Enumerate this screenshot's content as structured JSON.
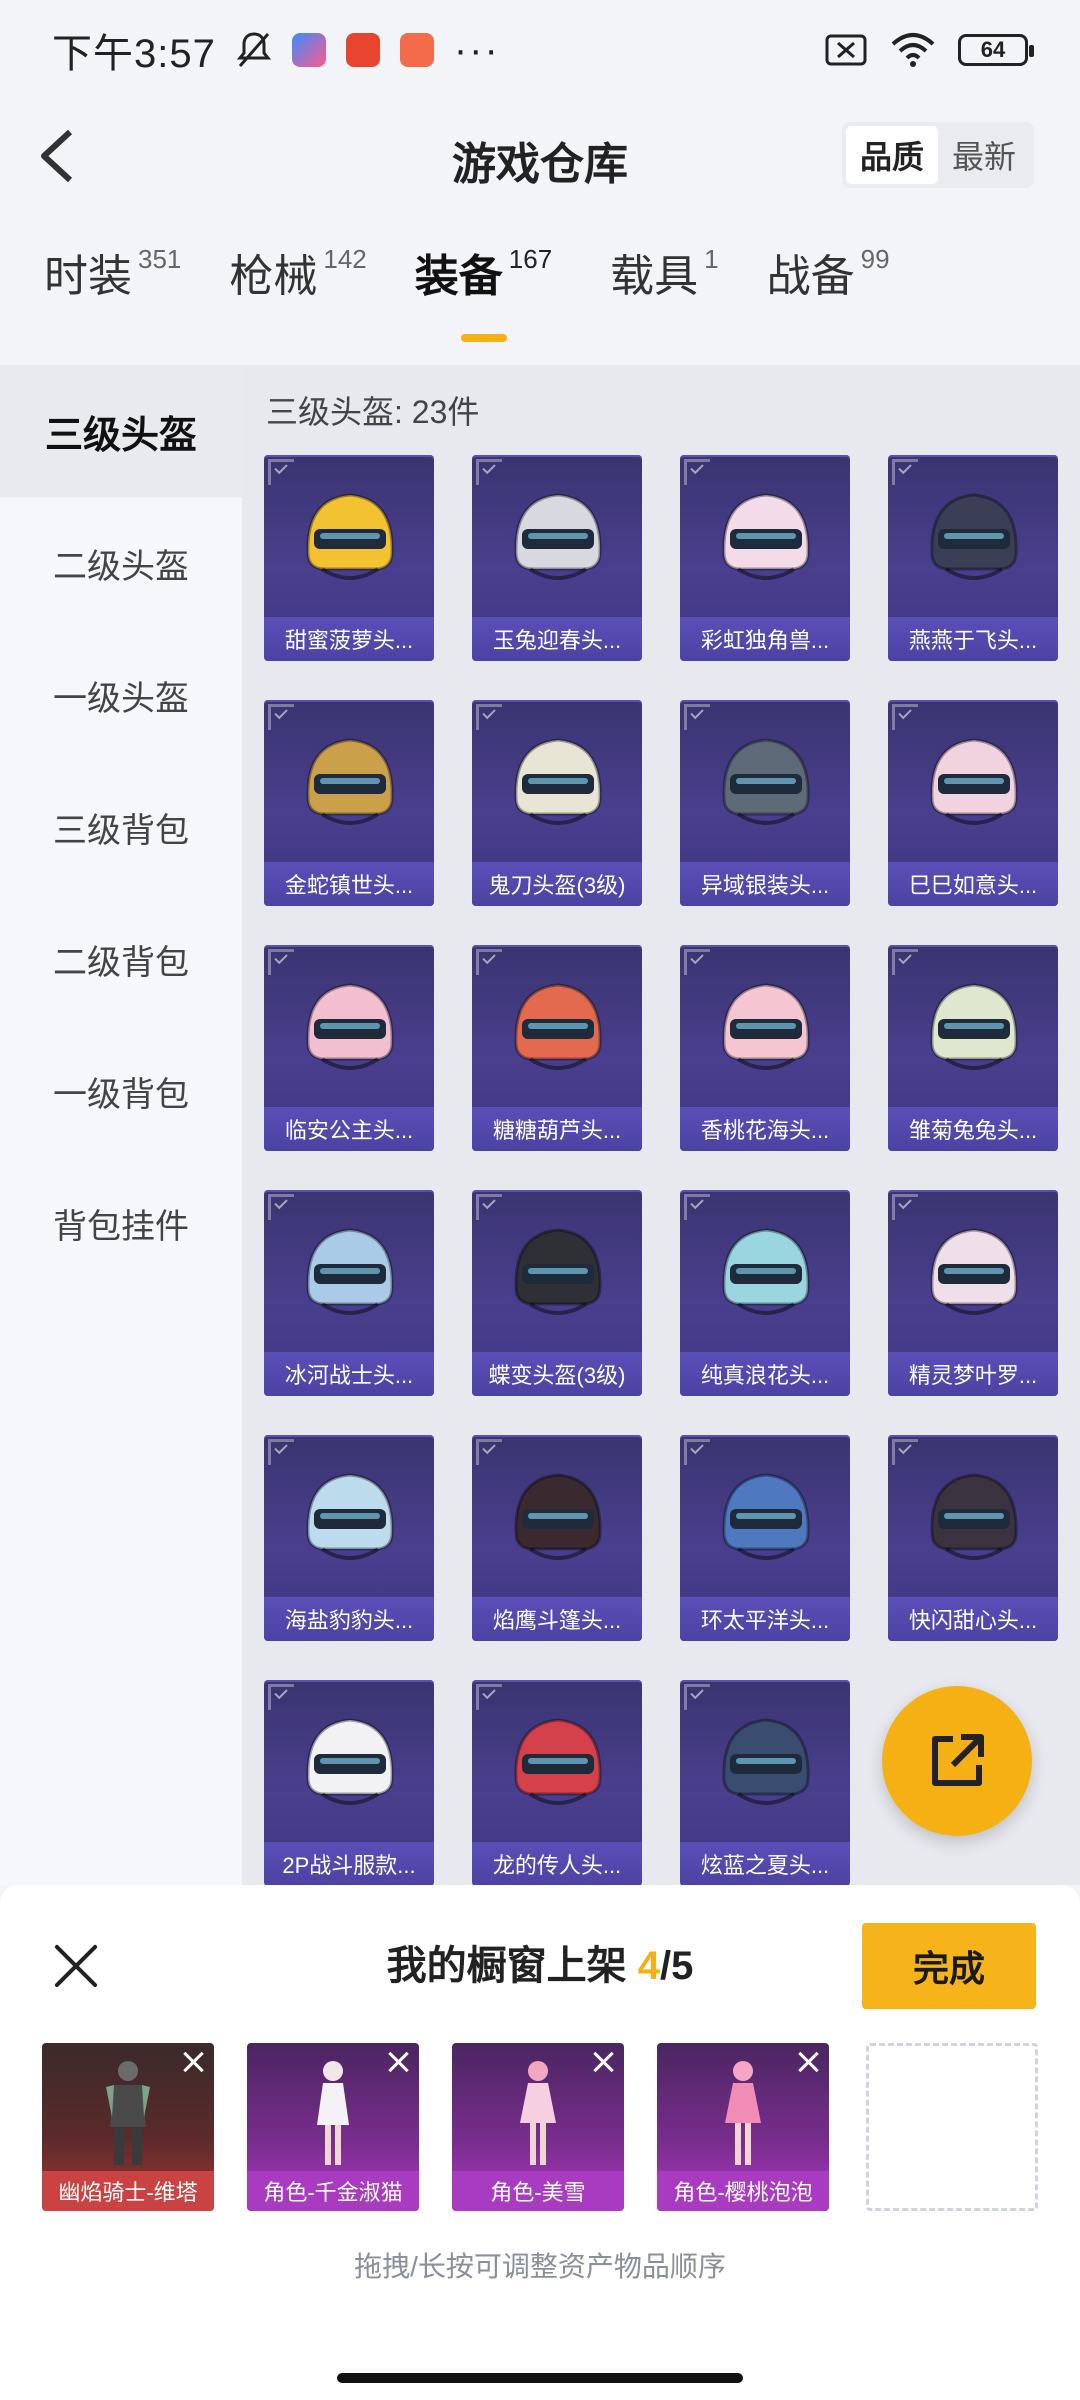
{
  "status_bar": {
    "time": "下午3:57",
    "battery": "64"
  },
  "header": {
    "title": "游戏仓库",
    "sort_options": [
      "品质",
      "最新"
    ],
    "sort_active": "品质"
  },
  "tabs": [
    {
      "label": "时装",
      "count": "351",
      "active": false
    },
    {
      "label": "枪械",
      "count": "142",
      "active": false
    },
    {
      "label": "装备",
      "count": "167",
      "active": true
    },
    {
      "label": "载具",
      "count": "1",
      "active": false
    },
    {
      "label": "战备",
      "count": "99",
      "active": false
    }
  ],
  "sidebar": {
    "items": [
      {
        "label": "三级头盔",
        "active": true
      },
      {
        "label": "二级头盔",
        "active": false
      },
      {
        "label": "一级头盔",
        "active": false
      },
      {
        "label": "三级背包",
        "active": false
      },
      {
        "label": "二级背包",
        "active": false
      },
      {
        "label": "一级背包",
        "active": false
      },
      {
        "label": "背包挂件",
        "active": false
      }
    ]
  },
  "content": {
    "category_title": "三级头盔: 23件",
    "items": [
      {
        "name": "甜蜜菠萝头...",
        "color": "#f2c230"
      },
      {
        "name": "玉兔迎春头...",
        "color": "#d8d8e0"
      },
      {
        "name": "彩虹独角兽...",
        "color": "#f4dbe8"
      },
      {
        "name": "燕燕于飞头...",
        "color": "#3b3f55"
      },
      {
        "name": "金蛇镇世头...",
        "color": "#caa14a"
      },
      {
        "name": "鬼刀头盔(3级)",
        "color": "#e9e5d5"
      },
      {
        "name": "异域银装头...",
        "color": "#5f6a78"
      },
      {
        "name": "巳巳如意头...",
        "color": "#f0d3de"
      },
      {
        "name": "临安公主头...",
        "color": "#f3bfd0"
      },
      {
        "name": "糖糖葫芦头...",
        "color": "#e36a4f"
      },
      {
        "name": "香桃花海头...",
        "color": "#f5c6d2"
      },
      {
        "name": "雏菊兔兔头...",
        "color": "#dfe8cf"
      },
      {
        "name": "冰河战士头...",
        "color": "#a9cbe8"
      },
      {
        "name": "蝶变头盔(3级)",
        "color": "#2f3036"
      },
      {
        "name": "纯真浪花头...",
        "color": "#9ad6e0"
      },
      {
        "name": "精灵梦叶罗...",
        "color": "#efdfe8"
      },
      {
        "name": "海盐豹豹头...",
        "color": "#bcdcee"
      },
      {
        "name": "焰鹰斗篷头...",
        "color": "#3a2a30"
      },
      {
        "name": "环太平洋头...",
        "color": "#4e78c0"
      },
      {
        "name": "快闪甜心头...",
        "color": "#3b3340"
      },
      {
        "name": "2P战斗服款...",
        "color": "#f2f2f4"
      },
      {
        "name": "龙的传人头...",
        "color": "#d5414a"
      },
      {
        "name": "炫蓝之夏头...",
        "color": "#3a4d70"
      }
    ]
  },
  "panel": {
    "title_prefix": "我的橱窗上架 ",
    "count_current": "4",
    "count_total": "/5",
    "done_label": "完成",
    "hint": "拖拽/长按可调整资产物品顺序",
    "slots": [
      {
        "name": "幽焰骑士-维塔",
        "style": "red"
      },
      {
        "name": "角色-千金淑猫",
        "style": "purple"
      },
      {
        "name": "角色-美雪",
        "style": "purple"
      },
      {
        "name": "角色-樱桃泡泡",
        "style": "purple"
      }
    ]
  },
  "colors": {
    "accent": "#f5b113",
    "card_bg": "#3f3780",
    "card_label_bg": "#5548ad"
  }
}
